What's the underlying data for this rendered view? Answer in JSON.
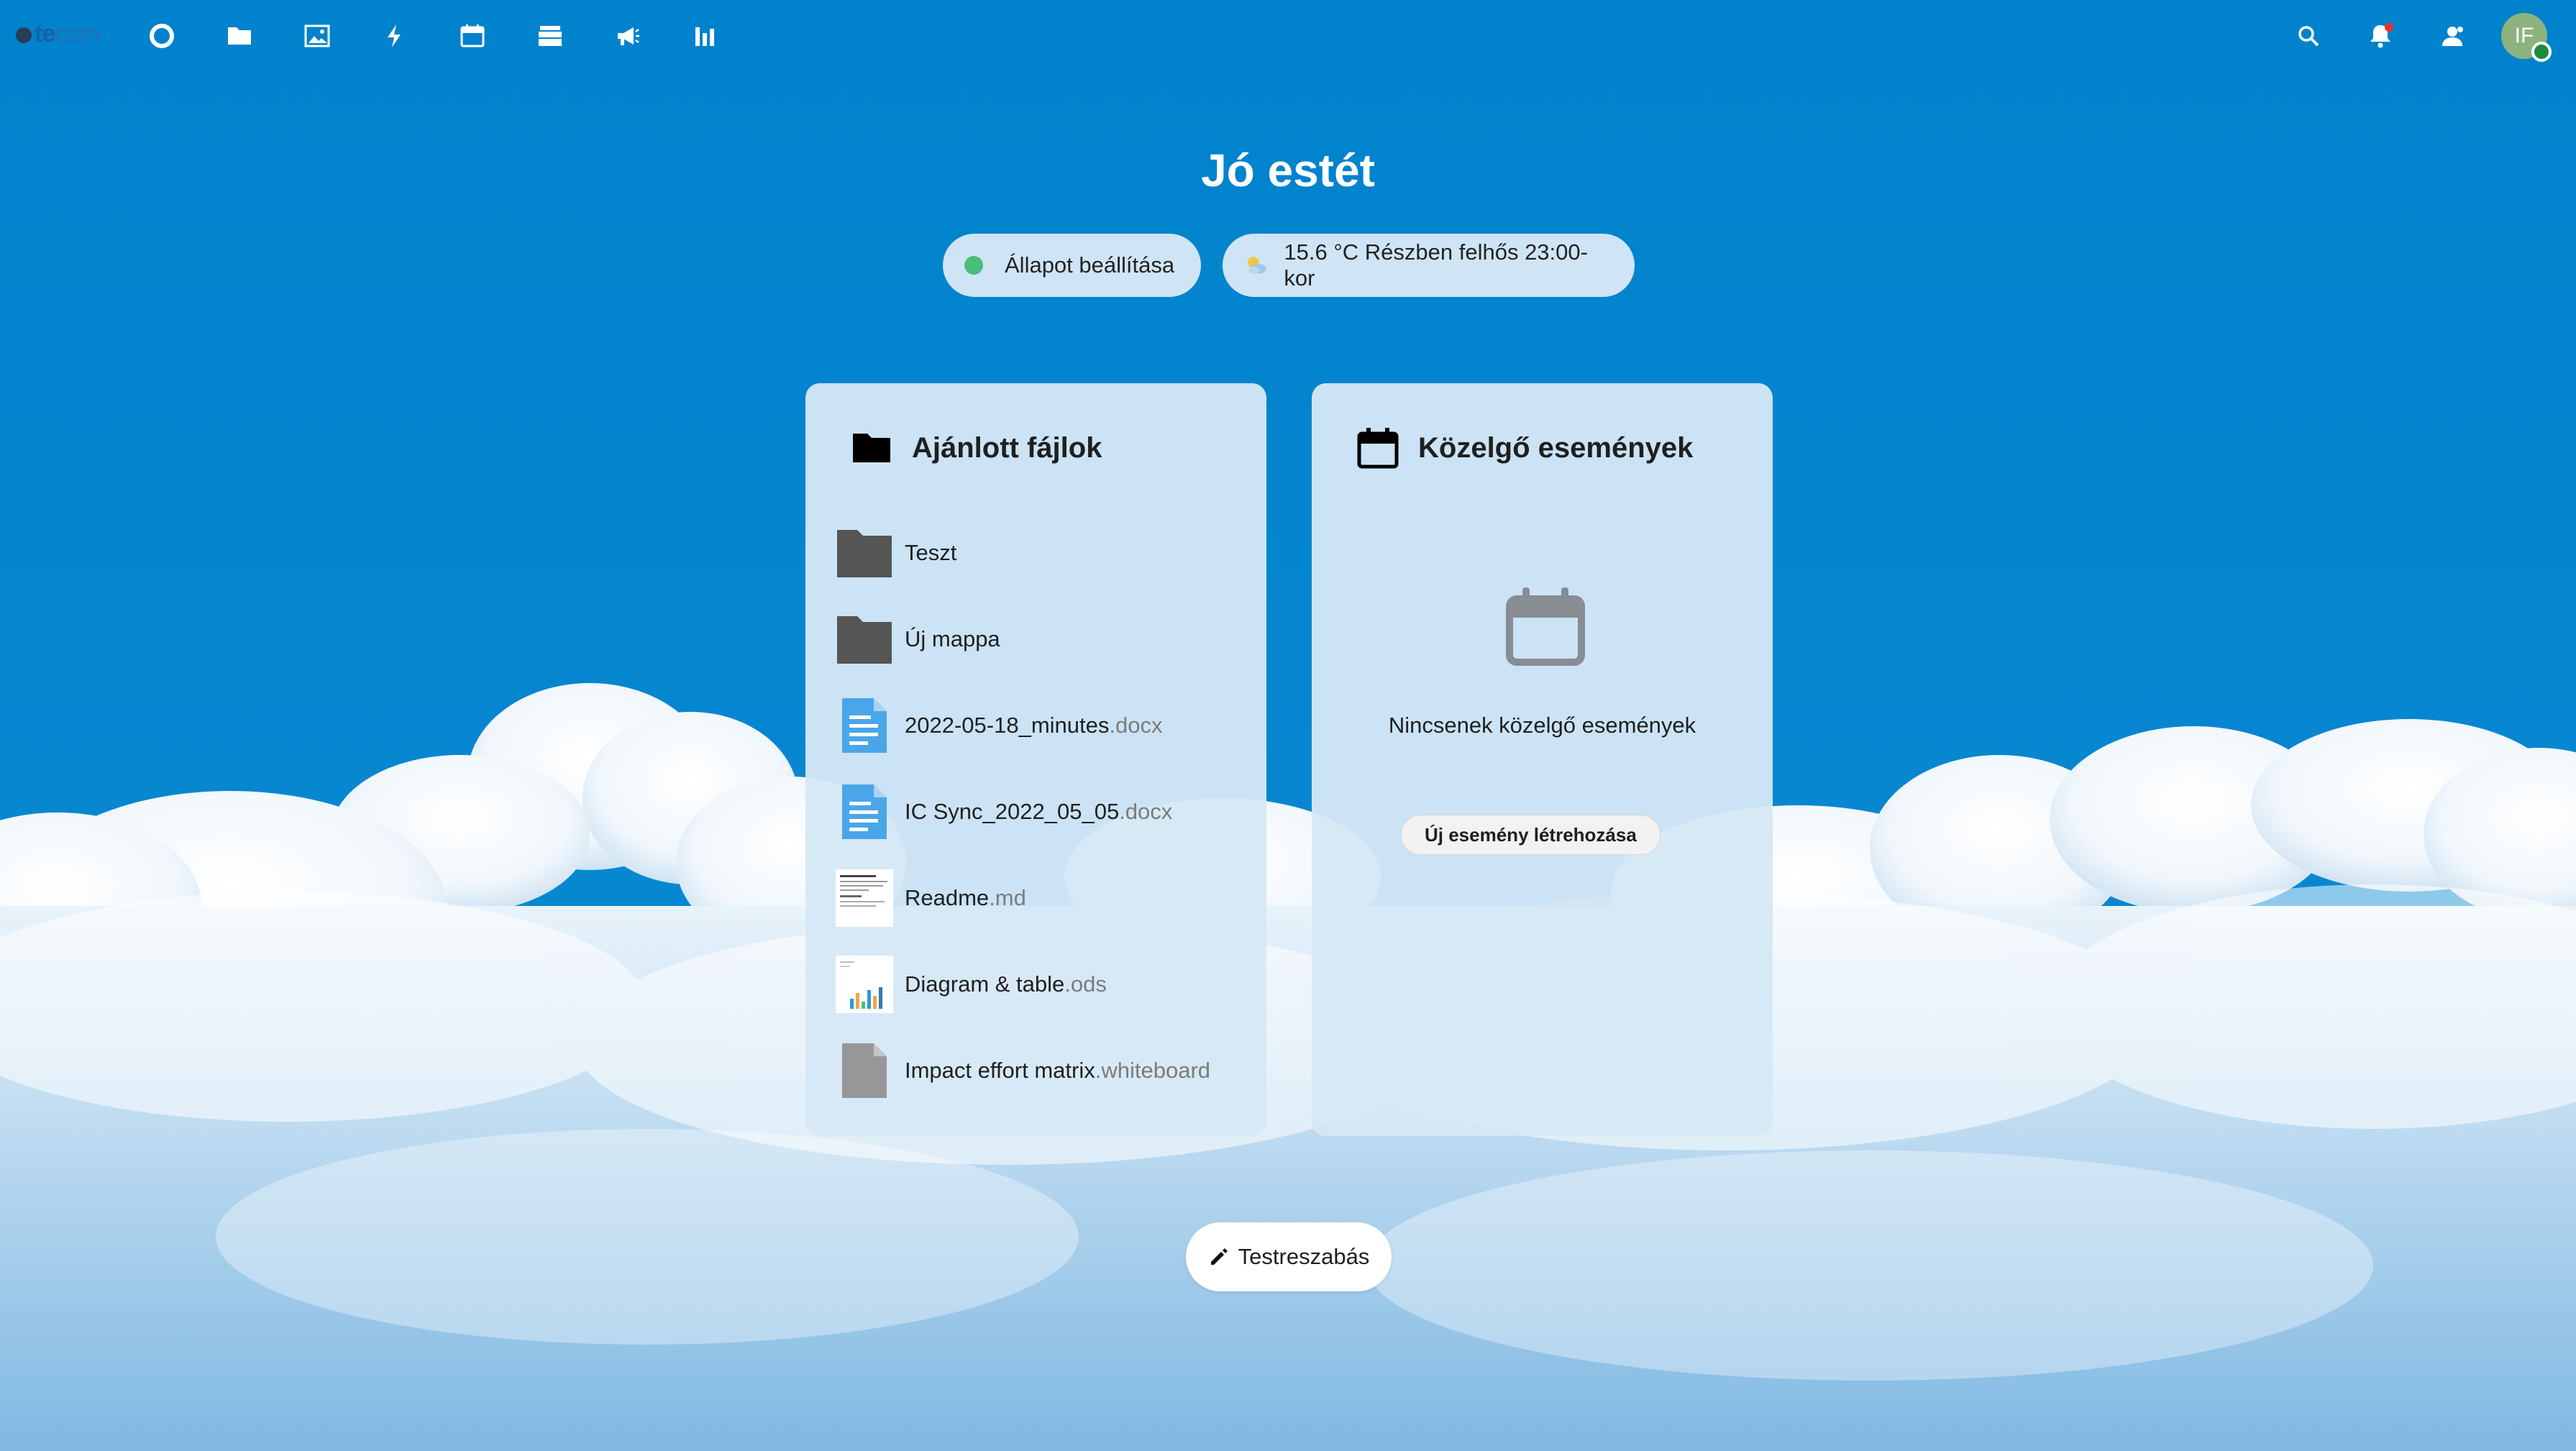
{
  "app": {
    "logo_text": "te",
    "logo_text_light": "com",
    "nav_icons": [
      "dashboard-icon",
      "files-icon",
      "photos-icon",
      "activity-icon",
      "calendar-icon",
      "deck-icon",
      "announcements-icon",
      "analytics-icon"
    ],
    "right_icons": [
      "search-icon",
      "notifications-icon",
      "contacts-icon"
    ],
    "avatar_initials": "IF"
  },
  "greeting": "Jó estét",
  "status_pill": {
    "label": "Állapot beállítása"
  },
  "weather_pill": {
    "label": "15.6 °C Részben felhős 23:00-kor"
  },
  "recommended_files": {
    "title": "Ajánlott fájlok",
    "items": [
      {
        "name": "Teszt",
        "ext": "",
        "type": "folder"
      },
      {
        "name": "Új mappa",
        "ext": "",
        "type": "folder"
      },
      {
        "name": "2022-05-18_minutes",
        "ext": ".docx",
        "type": "document"
      },
      {
        "name": "IC Sync_2022_05_05",
        "ext": ".docx",
        "type": "document"
      },
      {
        "name": "Readme",
        "ext": ".md",
        "type": "text-preview"
      },
      {
        "name": "Diagram & table",
        "ext": ".ods",
        "type": "spreadsheet-preview"
      },
      {
        "name": "Impact effort matrix",
        "ext": ".whiteboard",
        "type": "generic-file"
      }
    ]
  },
  "upcoming_events": {
    "title": "Közelgő események",
    "empty_text": "Nincsenek közelgő események",
    "new_event_label": "Új esemény létrehozása"
  },
  "customize_label": "Testreszabás",
  "colors": {
    "sky": "#0182cc",
    "card_bg": "#d6e8f6",
    "status_green": "#4bbd7c",
    "doc_blue": "#4aa6e8",
    "folder_gray": "#555555"
  }
}
